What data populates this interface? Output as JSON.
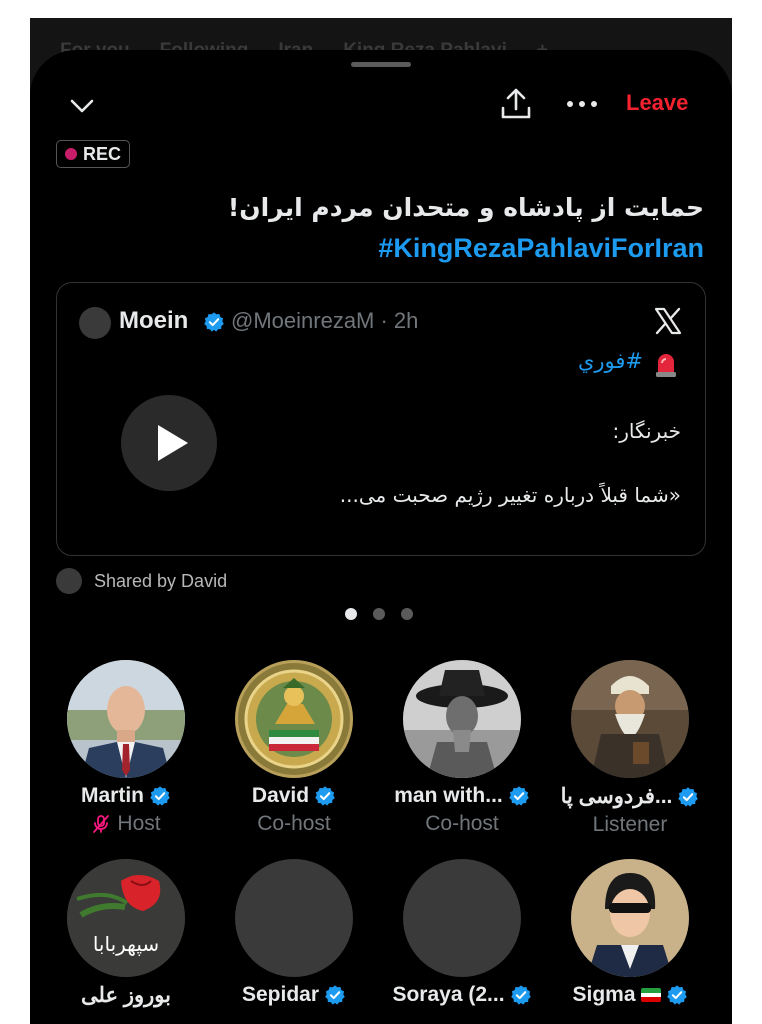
{
  "background_tabs": [
    "For you",
    "Following",
    "Iran",
    "King Reza Pahlavi",
    "+"
  ],
  "topbar": {
    "leave_label": "Leave"
  },
  "rec_label": "REC",
  "space": {
    "title": "حمایت از پادشاه و متحدان مردم ایران!",
    "hashtag": "#KingRezaPahlaviForIran"
  },
  "tweet": {
    "name": "Moein",
    "handle_time": "@MoeinrezaM · 2h",
    "tag": "#فوري",
    "line1": "خبرنگار:",
    "line2": "«شما قبلاً درباره تغییر رژیم صحبت می..."
  },
  "shared_by": "Shared by David",
  "pager": {
    "count": 3,
    "active": 1
  },
  "participants": [
    {
      "name": "Martin",
      "role": "Host",
      "muted": true,
      "verified": true
    },
    {
      "name": "David",
      "role": "Co-host",
      "verified": true
    },
    {
      "name": "man with...",
      "role": "Co-host",
      "verified": true
    },
    {
      "name": "فردوسی پا...",
      "role": "Listener",
      "verified": true
    },
    {
      "name": "بوروز علی",
      "verified": false,
      "avatar_text": "سپهربابا"
    },
    {
      "name": "Sepidar",
      "verified": true
    },
    {
      "name": "Soraya (2...",
      "verified": true
    },
    {
      "name": "Sigma",
      "verified": true,
      "flag": "iran"
    }
  ],
  "colors": {
    "accent": "#1d9bf0",
    "leave": "#f4212e",
    "rec_dot": "#c81d68",
    "muted_icon": "#f91880",
    "secondary_text": "#71767b"
  }
}
